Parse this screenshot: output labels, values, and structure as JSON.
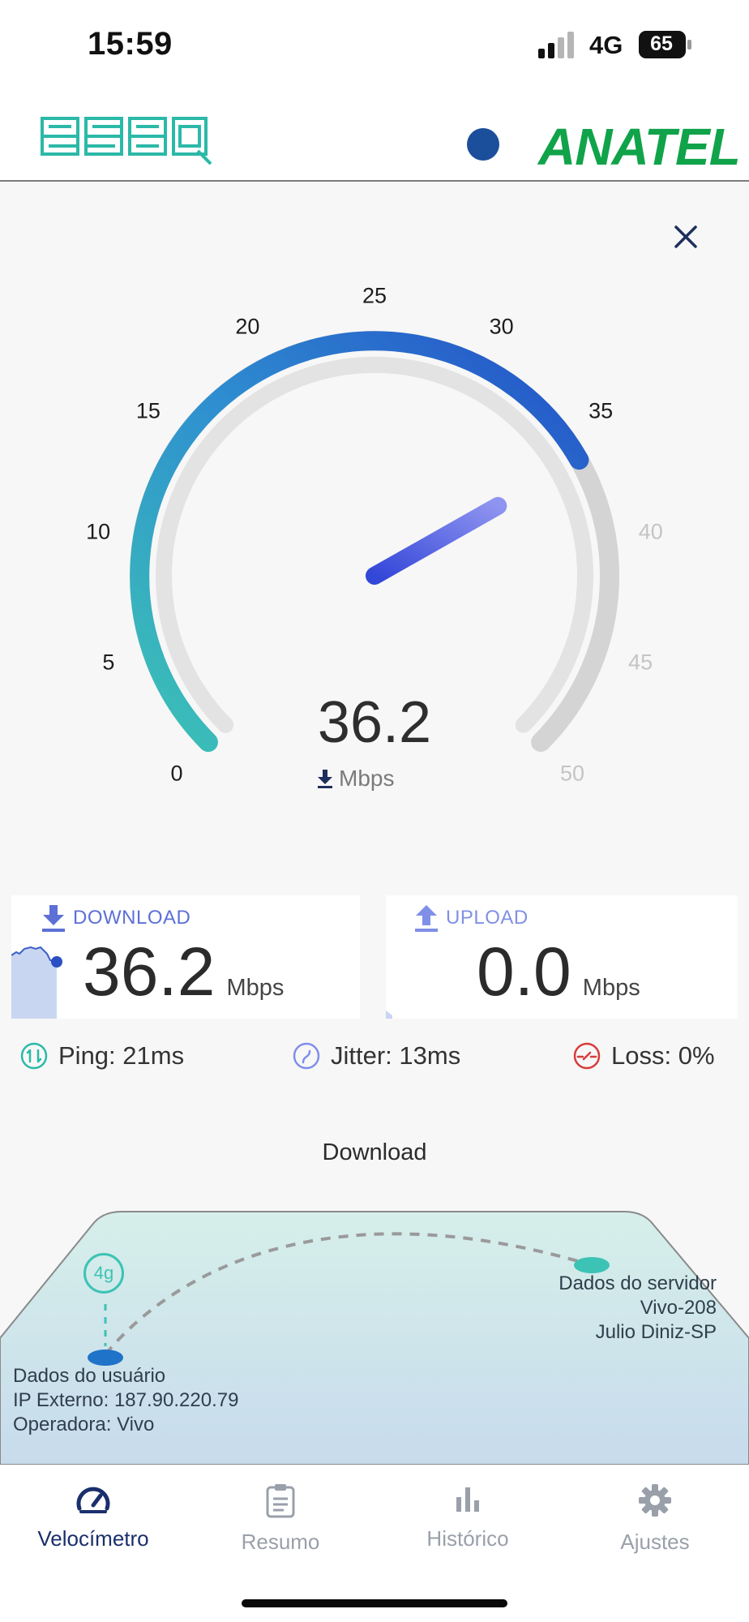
{
  "status_bar": {
    "time": "15:59",
    "network": "4G",
    "battery": "65"
  },
  "header": {
    "left_logo": "esaq",
    "right_logo": "ANATEL"
  },
  "gauge": {
    "ticks_active": [
      "0",
      "5",
      "10",
      "15",
      "20",
      "25",
      "30",
      "35"
    ],
    "ticks_inactive": [
      "40",
      "45",
      "50"
    ],
    "value": "36.2",
    "unit": "Mbps",
    "max": 50,
    "fill_value": 36.2
  },
  "download": {
    "label": "DOWNLOAD",
    "value": "36.2",
    "unit": "Mbps"
  },
  "upload": {
    "label": "UPLOAD",
    "value": "0.0",
    "unit": "Mbps"
  },
  "stats": {
    "ping": "Ping: 21ms",
    "jitter": "Jitter: 13ms",
    "loss": "Loss: 0%"
  },
  "map": {
    "title": "Download",
    "network_badge": "4g",
    "server_lines": [
      "Dados do servidor",
      "Vivo-208",
      "Julio Diniz-SP"
    ],
    "user_lines": [
      "Dados do usuário",
      "IP Externo: 187.90.220.79",
      "Operadora: Vivo"
    ]
  },
  "tabs": [
    {
      "label": "Velocímetro",
      "icon": "speedometer-icon",
      "active": true
    },
    {
      "label": "Resumo",
      "icon": "clipboard-icon",
      "active": false
    },
    {
      "label": "Histórico",
      "icon": "bar-chart-icon",
      "active": false
    },
    {
      "label": "Ajustes",
      "icon": "gear-icon",
      "active": false
    }
  ],
  "colors": {
    "accent_blue": "#2b5fd6",
    "accent_teal": "#3cc3b5",
    "anatel_green": "#10a34a",
    "anatel_yellow": "#f2d21a",
    "anatel_blue": "#1b4e9b",
    "esaq_teal": "#2bb9a8",
    "loss_red": "#d93a3a"
  }
}
